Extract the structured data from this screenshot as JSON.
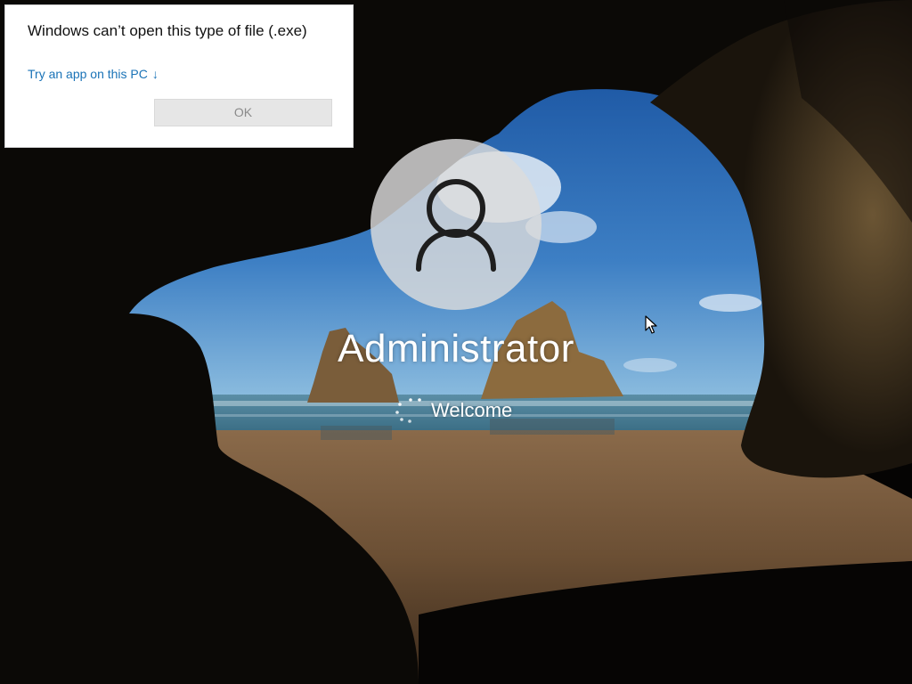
{
  "dialog": {
    "title": "Windows can’t open this type of file (.exe)",
    "link_label": "Try an app on this PC",
    "link_arrow": "↓",
    "ok_label": "OK"
  },
  "login": {
    "username": "Administrator",
    "status": "Welcome"
  },
  "icons": {
    "avatar": "user-silhouette-icon",
    "spinner": "loading-spinner-icon",
    "cursor": "mouse-pointer-icon",
    "link_arrow": "arrow-down-icon"
  },
  "colors": {
    "link": "#1a73b7",
    "dialog_bg": "#ffffff",
    "ok_button_bg": "#e6e6e6",
    "ok_button_text": "#8a8a8a",
    "text_light": "#ffffff"
  }
}
